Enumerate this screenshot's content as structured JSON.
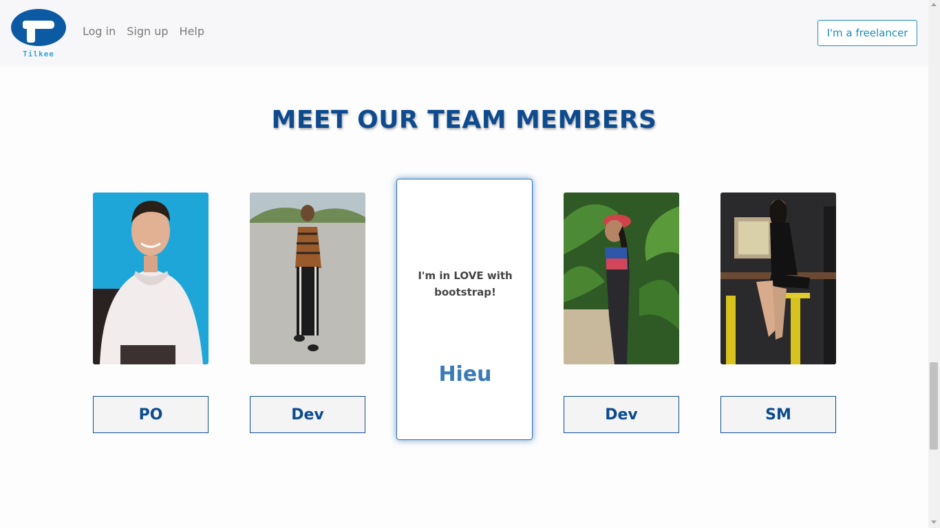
{
  "brand": {
    "name": "Tilkee",
    "logo_icon": "whale-logo-icon"
  },
  "nav": {
    "links": [
      {
        "label": "Log in"
      },
      {
        "label": "Sign up"
      },
      {
        "label": "Help"
      }
    ],
    "cta_label": "I'm a freelancer"
  },
  "section": {
    "title": "MEET OUR TEAM MEMBERS"
  },
  "members": [
    {
      "role": "PO"
    },
    {
      "role": "Dev"
    },
    {
      "role": "Dev"
    },
    {
      "role": "SM"
    }
  ],
  "flip_card": {
    "quote": "I'm in LOVE with bootstrap!",
    "name": "Hieu"
  },
  "colors": {
    "brand_blue": "#0d4b8e",
    "accent_blue": "#1a8bbd",
    "logo_blue": "#0b5aa3",
    "logo_text": "#3aa1dd"
  }
}
